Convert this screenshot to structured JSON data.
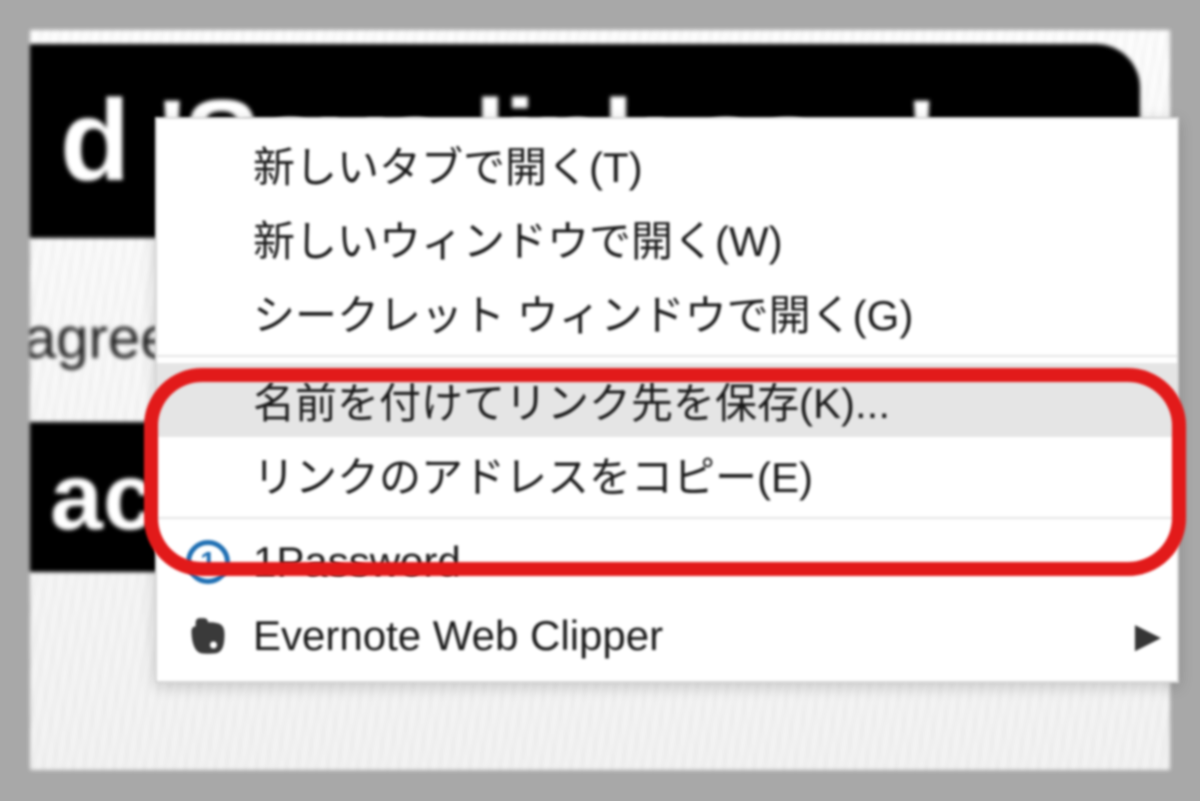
{
  "page": {
    "pill_top_text": "d 'Save link as...'",
    "agree_text": "agree",
    "pill_bottom_text": "ack"
  },
  "context_menu": {
    "items": [
      {
        "label": "新しいタブで開く(T)"
      },
      {
        "label": "新しいウィンドウで開く(W)"
      },
      {
        "label": "シークレット ウィンドウで開く(G)"
      }
    ],
    "highlighted_item": {
      "label": "名前を付けてリンク先を保存(K)..."
    },
    "copy_item": {
      "label": "リンクのアドレスをコピー(E)"
    },
    "extensions": {
      "onepassword": {
        "label": "1Password"
      },
      "evernote": {
        "label": "Evernote Web Clipper"
      }
    }
  },
  "colors": {
    "highlight_border": "#e21a1a"
  }
}
